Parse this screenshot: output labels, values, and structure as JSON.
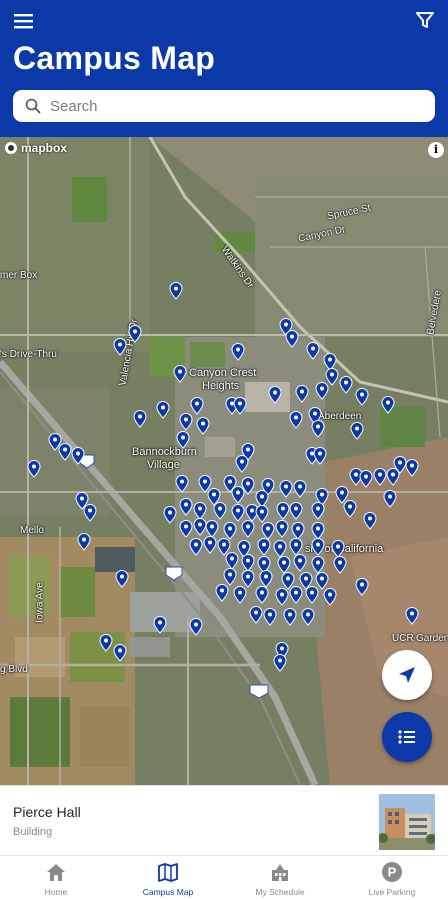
{
  "header": {
    "title": "Campus Map",
    "menu_icon": "hamburger-menu-icon",
    "filter_icon": "filter-icon",
    "background": "#0b3aa8"
  },
  "search": {
    "placeholder": "Search",
    "value": ""
  },
  "map": {
    "attribution_logo": "mapbox",
    "info_icon": "i",
    "labels": {
      "canyon_crest": "Canyon Crest",
      "heights": "Heights",
      "bannockburn": "Bannockburn",
      "village": "Village",
      "spruce_st": "Spruce St",
      "watkins_dr": "Watkins Dr",
      "box_springs": "mer Box",
      "drive_thru": "'s Drive-Thru",
      "aberdeen": "Aberdeen",
      "univ_california": "sity of California",
      "ucr": "UCR",
      "ucr_gardens": "Gardens",
      "blvd": "g Blvd",
      "iowa_ave": "Iowa Ave",
      "valencia": "Valencia Hill Dr",
      "ave_label": "Mello",
      "belvedere": "Belvedere",
      "canyon_dr": "Canyon Dr"
    },
    "highway_shields": [
      "215",
      "215",
      "215"
    ],
    "pin_color": "#0b3aa8"
  },
  "buttons": {
    "locate_icon": "navigation-arrow-icon",
    "list_icon": "list-icon"
  },
  "selected_place": {
    "name": "Pierce Hall",
    "category": "Building"
  },
  "tabs": [
    {
      "label": "Home",
      "icon": "home-icon",
      "active": false
    },
    {
      "label": "Campus Map",
      "icon": "map-icon",
      "active": true
    },
    {
      "label": "My Schedule",
      "icon": "schedule-building-icon",
      "active": false
    },
    {
      "label": "Live Parking",
      "icon": "parking-icon",
      "active": false
    }
  ]
}
